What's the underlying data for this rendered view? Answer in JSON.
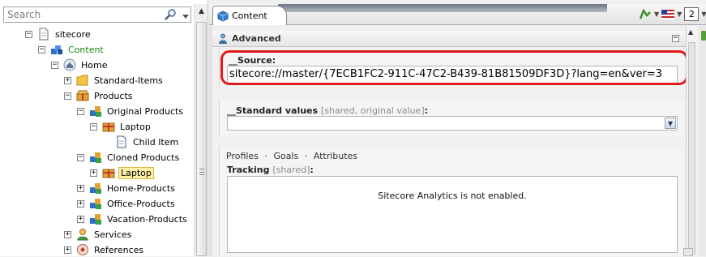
{
  "search": {
    "placeholder": "Search",
    "icon": "magnifier-icon"
  },
  "tree": [
    {
      "label": "sitecore",
      "toggle": "−",
      "icon": "document-icon"
    },
    {
      "label": "Content",
      "toggle": "−",
      "icon": "content-icon"
    },
    {
      "label": "Home",
      "toggle": "−",
      "icon": "home-icon"
    },
    {
      "label": "Standard-Items",
      "toggle": "+",
      "icon": "folder-icon"
    },
    {
      "label": "Products",
      "toggle": "−",
      "icon": "products-icon"
    },
    {
      "label": "Original Products",
      "toggle": "−",
      "icon": "group-icon"
    },
    {
      "label": "Laptop",
      "toggle": "−",
      "icon": "box-icon"
    },
    {
      "label": "Child Item",
      "toggle": "",
      "icon": "page-icon"
    },
    {
      "label": "Cloned Products",
      "toggle": "−",
      "icon": "group-icon"
    },
    {
      "label": "Laptop",
      "toggle": "+",
      "icon": "box-icon",
      "selected": true
    },
    {
      "label": "Home-Products",
      "toggle": "+",
      "icon": "group-icon"
    },
    {
      "label": "Office-Products",
      "toggle": "+",
      "icon": "group-icon"
    },
    {
      "label": "Vacation-Products",
      "toggle": "+",
      "icon": "group-icon"
    },
    {
      "label": "Services",
      "toggle": "+",
      "icon": "person-icon"
    },
    {
      "label": "References",
      "toggle": "+",
      "icon": "references-icon"
    }
  ],
  "tabs": {
    "content_label": "Content",
    "version_label": "2"
  },
  "section": {
    "title": "Advanced",
    "collapse": "−"
  },
  "fields": {
    "source_label": "__Source:",
    "source_value": "sitecore://master/{7ECB1FC2-911C-47C2-B439-81B81509DF3D}?lang=en&ver=3",
    "standard_values_label": "__Standard values",
    "standard_values_note": "[shared, original value]",
    "standard_values_colon": ":",
    "links": [
      "Profiles",
      "Goals",
      "Attributes"
    ],
    "link_separator": "·",
    "tracking_label": "Tracking",
    "tracking_note": "[shared]",
    "tracking_colon": ":",
    "tracking_message": "Sitecore Analytics is not enabled."
  },
  "colors": {
    "highlight": "#e11a1a",
    "content_green": "#138a13",
    "selection": "#fff0a8"
  }
}
